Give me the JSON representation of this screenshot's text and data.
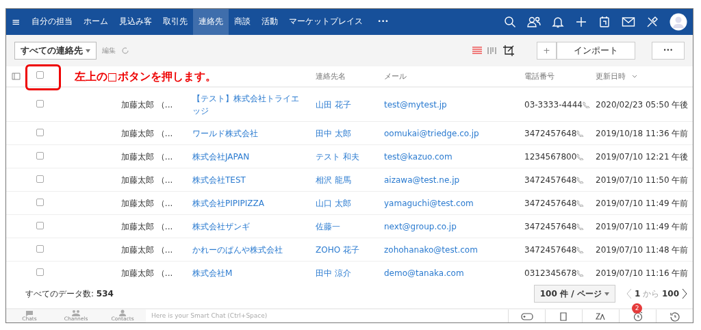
{
  "nav": {
    "menu_icon": "≡",
    "tabs": [
      {
        "label": "自分の担当",
        "selected": false
      },
      {
        "label": "ホーム",
        "selected": false
      },
      {
        "label": "見込み客",
        "selected": false
      },
      {
        "label": "取引先",
        "selected": false
      },
      {
        "label": "連絡先",
        "selected": true
      },
      {
        "label": "商談",
        "selected": false
      },
      {
        "label": "活動",
        "selected": false
      },
      {
        "label": "マーケットプレイス",
        "selected": false
      }
    ],
    "more": "•••"
  },
  "toolbar": {
    "view_select": "すべての連絡先",
    "edit_link": "編集",
    "import_button": "インポート",
    "add_button": "+",
    "more_button": "•••"
  },
  "annotation": "左上の□ボタンを押します。",
  "table": {
    "select_all_checked": false,
    "columns": [
      {
        "label": "連絡先名"
      },
      {
        "label": "メール"
      },
      {
        "label": "電話番号"
      },
      {
        "label": "更新日時"
      }
    ],
    "rows": [
      {
        "owner": "加藤太郎 （...",
        "company": "【テスト】株式会社トライエッジ",
        "contact": "山田 花子",
        "email": "test@mytest.jp",
        "phone": "03-3333-4444",
        "updated": "2020/02/23 05:50 午後",
        "checked": false
      },
      {
        "owner": "加藤太郎 （...",
        "company": "ワールド株式会社",
        "contact": "田中 太郎",
        "email": "oomukai@triedge.co.jp",
        "phone": "3472457648",
        "updated": "2019/10/18 11:36 午前",
        "checked": false
      },
      {
        "owner": "加藤太郎 （...",
        "company": "株式会社JAPAN",
        "contact": "テスト 和夫",
        "email": "test@kazuo.com",
        "phone": "1234567800",
        "updated": "2019/07/10 12:21 午後",
        "checked": false
      },
      {
        "owner": "加藤太郎 （...",
        "company": "株式会社TEST",
        "contact": "相沢 龍馬",
        "email": "aizawa@test.ne.jp",
        "phone": "3472457648",
        "updated": "2019/07/10 11:50 午前",
        "checked": false
      },
      {
        "owner": "加藤太郎 （...",
        "company": "株式会社PIPIPIZZA",
        "contact": "山口 太郎",
        "email": "yamaguchi@test.com",
        "phone": "3472457648",
        "updated": "2019/07/10 11:49 午前",
        "checked": false
      },
      {
        "owner": "加藤太郎 （...",
        "company": "株式会社ザンギ",
        "contact": "佐藤一",
        "email": "next@group.co.jp",
        "phone": "3472457648",
        "updated": "2019/07/10 11:49 午前",
        "checked": false
      },
      {
        "owner": "加藤太郎 （...",
        "company": "かれーのぱんや株式会社",
        "contact": "ZOHO 花子",
        "email": "zohohanako@test.com",
        "phone": "3472457648",
        "updated": "2019/07/10 11:48 午前",
        "checked": false
      },
      {
        "owner": "加藤太郎 （...",
        "company": "株式会社M",
        "contact": "田中 涼介",
        "email": "demo@tanaka.com",
        "phone": "0312345678",
        "updated": "2019/07/10 11:16 午前",
        "checked": false
      }
    ]
  },
  "footer": {
    "total_label": "すべてのデータ数:",
    "total": "534",
    "page_size": "100 件 / ページ",
    "page_from": "1",
    "page_sep": "から",
    "page_to": "100"
  },
  "bottom_bar": {
    "tabs": [
      "Chats",
      "Channels",
      "Contacts"
    ],
    "chat_placeholder": "Here is your Smart Chat (Ctrl+Space)",
    "reminder_badge": "2"
  }
}
